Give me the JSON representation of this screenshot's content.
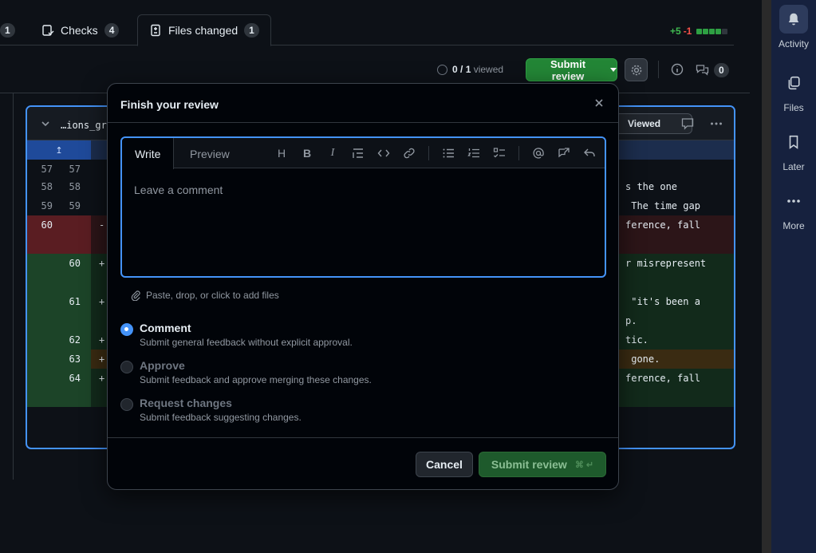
{
  "tabs": [
    {
      "label": "",
      "count": "1"
    },
    {
      "label": "Checks",
      "count": "4"
    },
    {
      "label": "Files changed",
      "count": "1"
    }
  ],
  "diffstat": {
    "additions": "+5",
    "deletions": "-1"
  },
  "toolbar": {
    "viewed_done": "0",
    "viewed_total": "/ 1",
    "viewed_suffix": "viewed",
    "submit_label": "Submit review",
    "comment_count": "0"
  },
  "file": {
    "name": "…ions_gr",
    "viewed_label": "Viewed",
    "hunk_icon": "↥",
    "lines": [
      {
        "old": "57",
        "new": "57",
        "type": "ctx",
        "sign": "",
        "text": ""
      },
      {
        "old": "58",
        "new": "58",
        "type": "ctx",
        "sign": "",
        "text": "s the one"
      },
      {
        "old": "59",
        "new": "59",
        "type": "ctx",
        "sign": "",
        "text": " The time gap"
      },
      {
        "old": "60",
        "new": "",
        "type": "del",
        "sign": "-",
        "text": "ference, fall"
      },
      {
        "old": "",
        "new": "60",
        "type": "add",
        "sign": "+",
        "text": "r misrepresent"
      },
      {
        "old": "",
        "new": "61",
        "type": "add",
        "sign": "+",
        "text": " \"it's been a"
      },
      {
        "old": "",
        "new": "",
        "type": "add",
        "sign": "",
        "text": "p."
      },
      {
        "old": "",
        "new": "62",
        "type": "add",
        "sign": "+",
        "text": "tic."
      },
      {
        "old": "",
        "new": "63",
        "type": "hl",
        "sign": "+",
        "text": " gone."
      },
      {
        "old": "",
        "new": "64",
        "type": "add",
        "sign": "+",
        "text": "ference, fall"
      }
    ]
  },
  "sidebar": [
    {
      "label": "Activity",
      "icon": "bell-icon"
    },
    {
      "label": "Files",
      "icon": "files-icon"
    },
    {
      "label": "Later",
      "icon": "bookmark-icon"
    },
    {
      "label": "More",
      "icon": "more-icon"
    }
  ],
  "modal": {
    "title": "Finish your review",
    "tab_write": "Write",
    "tab_preview": "Preview",
    "placeholder": "Leave a comment",
    "attach": "Paste, drop, or click to add files",
    "options": [
      {
        "label": "Comment",
        "desc": "Submit general feedback without explicit approval.",
        "selected": true
      },
      {
        "label": "Approve",
        "desc": "Submit feedback and approve merging these changes.",
        "selected": false
      },
      {
        "label": "Request changes",
        "desc": "Submit feedback suggesting changes.",
        "selected": false
      }
    ],
    "cancel_label": "Cancel",
    "submit_label": "Submit review",
    "submit_shortcut": "⌘ ↵"
  },
  "colors": {
    "accent": "#4493f8",
    "primary_green": "#238636",
    "bg": "#0d1117"
  }
}
